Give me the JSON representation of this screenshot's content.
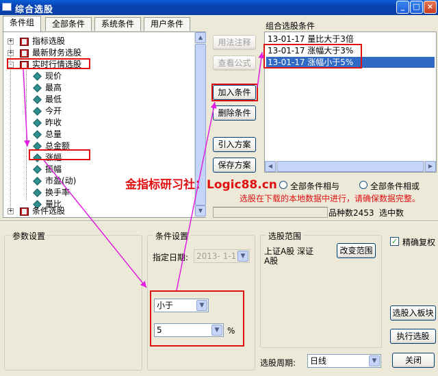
{
  "window": {
    "title": "综合选股"
  },
  "tabs": [
    {
      "label": "条件组"
    },
    {
      "label": "全部条件"
    },
    {
      "label": "系统条件"
    },
    {
      "label": "用户条件"
    }
  ],
  "tree": {
    "groups": [
      {
        "label": "指标选股",
        "expander": "+"
      },
      {
        "label": "最新财务选股",
        "expander": "+"
      },
      {
        "label": "实时行情选股",
        "expander": "-"
      },
      {
        "label": "条件选股",
        "expander": "+"
      }
    ],
    "children": [
      "现价",
      "最高",
      "最低",
      "今开",
      "昨收",
      "总量",
      "总金额",
      "涨幅",
      "振幅",
      "市盈(动)",
      "换手率",
      "量比"
    ]
  },
  "buttons": {
    "explain": "用法注释",
    "view_formula": "查看公式",
    "add_condition": "加入条件",
    "delete_condition": "删除条件",
    "import_plan": "引入方案",
    "save_plan": "保存方案",
    "change_range": "改变范围",
    "select_to_block": "选股入板块",
    "execute": "执行选股",
    "close": "关闭"
  },
  "conditions": {
    "header": "组合选股条件",
    "items": [
      {
        "text": "13-01-17 量比大于3倍",
        "selected": false
      },
      {
        "text": "13-01-17 涨幅大于3%",
        "selected": false
      },
      {
        "text": "13-01-17 涨幅小于5%",
        "selected": true
      }
    ]
  },
  "logic": {
    "and_label": "全部条件相与",
    "or_label": "全部条件相或"
  },
  "notice": "选股在下载的本地数据中进行，请确保数据完整。",
  "watermark": "金指标研习社：Logic88.cn",
  "status": {
    "count_label": "品种数2453",
    "selected_label": "选中数"
  },
  "param_group": {
    "title": "参数设置"
  },
  "condition_group": {
    "title": "条件设置",
    "date_label": "指定日期:",
    "date_value": "2013- 1-17",
    "operator": "小于",
    "value": "5",
    "unit": "%"
  },
  "range_group": {
    "title": "选股范围",
    "range_text_line1": "上证A股 深证",
    "range_text_line2": "A股"
  },
  "adjust": {
    "label": "精确复权",
    "checked": true
  },
  "period": {
    "label": "选股周期:",
    "value": "日线"
  },
  "colors": {
    "highlight": "#e01010",
    "arrow": "#e020e0",
    "selection": "#316ac5"
  }
}
